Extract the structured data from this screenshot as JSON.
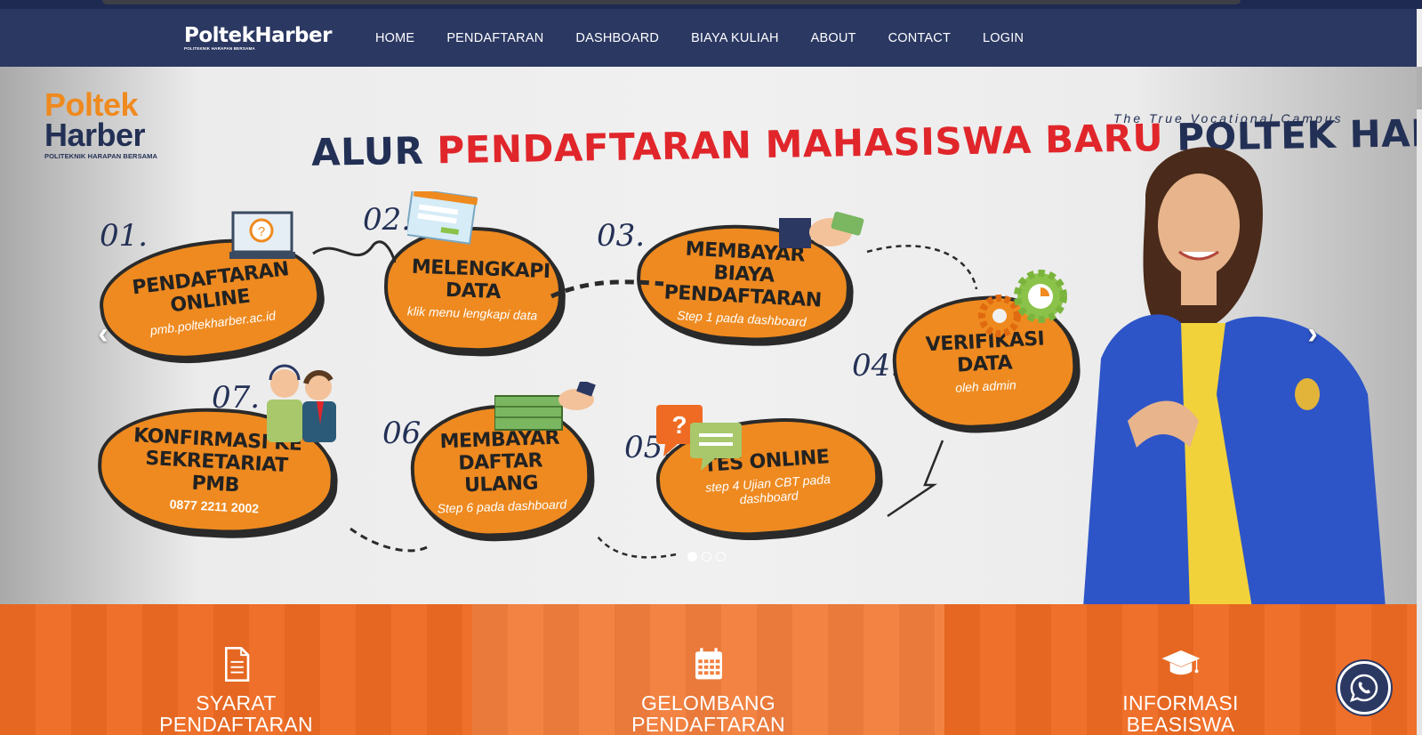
{
  "navbar": {
    "brand": "PoltekHarber",
    "brand_sub": "POLITEKNIK HARAPAN BERSAMA",
    "links": [
      "HOME",
      "PENDAFTARAN",
      "DASHBOARD",
      "BIAYA KULIAH",
      "ABOUT",
      "CONTACT",
      "LOGIN"
    ]
  },
  "hero": {
    "logo_line1": "Poltek",
    "logo_line2": "Harber",
    "logo_sub": "POLITEKNIK HARAPAN BERSAMA",
    "tagline": "The True Vocational Campus",
    "headline_part1": "ALUR ",
    "headline_part2": "PENDAFTARAN MAHASISWA BARU",
    "headline_part3": " POLTEK HARBER",
    "steps": [
      {
        "num": "01.",
        "title": "PENDAFTARAN ONLINE",
        "sub": "pmb.poltekharber.ac.id"
      },
      {
        "num": "02.",
        "title": "MELENGKAPI DATA",
        "sub": "klik menu lengkapi data"
      },
      {
        "num": "03.",
        "title": "MEMBAYAR BIAYA PENDAFTARAN",
        "sub": "Step 1 pada dashboard"
      },
      {
        "num": "04.",
        "title": "VERIFIKASI DATA",
        "sub": "oleh admin"
      },
      {
        "num": "05.",
        "title": "TES ONLINE",
        "sub": "step 4 Ujian CBT pada dashboard"
      },
      {
        "num": "06.",
        "title": "MEMBAYAR DAFTAR ULANG",
        "sub": "Step 6 pada dashboard"
      },
      {
        "num": "07.",
        "title": "KONFIRMASI KE SEKRETARIAT PMB",
        "sub": "0877 2211 2002"
      }
    ],
    "prev": "‹",
    "next": "›",
    "slides_total": 3,
    "active_slide": 1
  },
  "features": [
    {
      "label_line1": "SYARAT",
      "label_line2": "PENDAFTARAN",
      "icon": "document-icon"
    },
    {
      "label_line1": "GELOMBANG",
      "label_line2": "PENDAFTARAN",
      "icon": "calendar-icon"
    },
    {
      "label_line1": "INFORMASI",
      "label_line2": "BEASISWA",
      "icon": "graduation-cap-icon"
    }
  ],
  "colors": {
    "navbar": "#2b3862",
    "accent_orange": "#ee8a20",
    "feature_orange": "#ee6b23",
    "headline_red": "#e0262b",
    "navy": "#233055"
  }
}
